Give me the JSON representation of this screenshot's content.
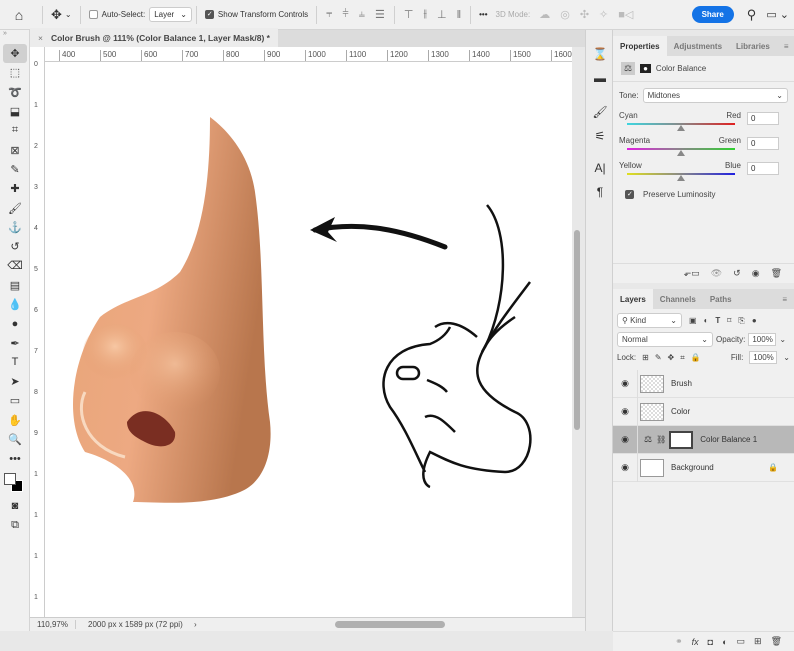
{
  "options_bar": {
    "auto_select_label": "Auto-Select:",
    "auto_select_checked": false,
    "layer_select": "Layer",
    "show_transform_label": "Show Transform Controls",
    "show_transform_checked": true,
    "more": "•••",
    "mode_3d_label": "3D Mode:",
    "share_label": "Share"
  },
  "document": {
    "tab_title": "Color Brush @ 111% (Color Balance 1, Layer Mask/8) *",
    "close": "×"
  },
  "ruler": {
    "h_ticks": [
      "400",
      "500",
      "600",
      "700",
      "800",
      "900",
      "1000",
      "1100",
      "1200",
      "1300",
      "1400",
      "1500",
      "1600"
    ],
    "v_ticks": [
      "0",
      "1",
      "2",
      "3",
      "4",
      "5",
      "6",
      "7",
      "8",
      "9",
      "1",
      "1",
      "1",
      "1"
    ]
  },
  "status": {
    "zoom": "110,97%",
    "doc_info": "2000 px x 1589 px (72 ppi)",
    "arrow": "›"
  },
  "properties": {
    "tabs": [
      "Properties",
      "Adjustments",
      "Libraries"
    ],
    "title": "Color Balance",
    "tone_label": "Tone:",
    "tone_value": "Midtones",
    "sliders": [
      {
        "left": "Cyan",
        "right": "Red",
        "value": "0",
        "from": "#3ed6e0",
        "to": "#e02020"
      },
      {
        "left": "Magenta",
        "right": "Green",
        "value": "0",
        "from": "#e020e0",
        "to": "#30d030"
      },
      {
        "left": "Yellow",
        "right": "Blue",
        "value": "0",
        "from": "#e0e020",
        "to": "#2020e0"
      }
    ],
    "preserve_label": "Preserve Luminosity",
    "preserve_checked": true
  },
  "layers": {
    "tabs": [
      "Layers",
      "Channels",
      "Paths"
    ],
    "filter": "Kind",
    "blend_mode": "Normal",
    "opacity_label": "Opacity:",
    "opacity": "100%",
    "lock_label": "Lock:",
    "fill_label": "Fill:",
    "fill": "100%",
    "items": [
      {
        "name": "Brush",
        "selected": false
      },
      {
        "name": "Color",
        "selected": false
      },
      {
        "name": "Color Balance 1",
        "selected": true
      },
      {
        "name": "Background",
        "selected": false,
        "locked": true
      }
    ]
  }
}
